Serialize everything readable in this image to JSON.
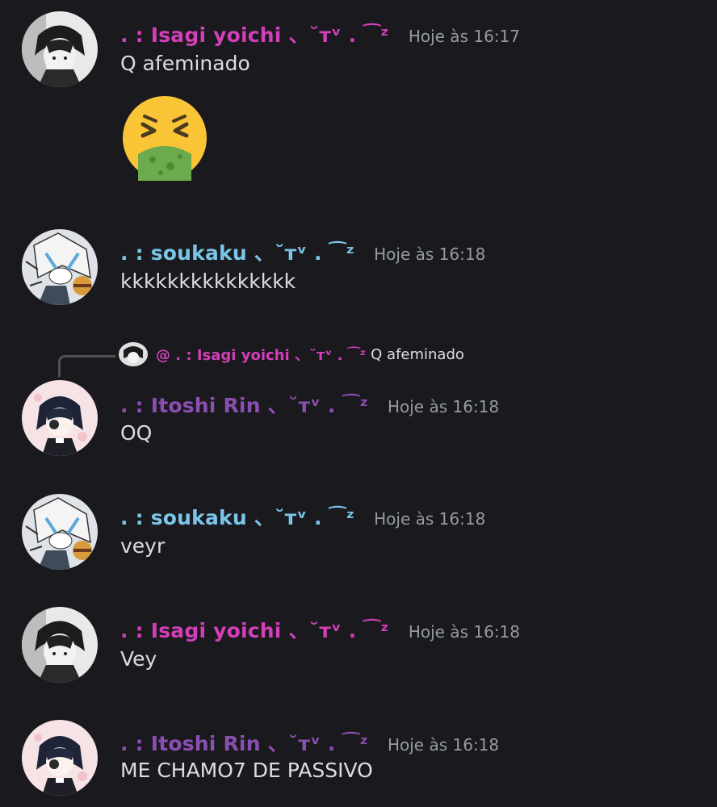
{
  "messages": [
    {
      "username": ". : Isagi yoichi 、˘ᴛᵛ . ⁀ᶻ",
      "timestamp": "Hoje às 16:17",
      "text": "Q afeminado"
    },
    {
      "username": ". : soukaku 、˘ᴛᵛ . ⁀ᶻ",
      "timestamp": "Hoje às 16:18",
      "text": "kkkkkkkkkkkkkkk"
    },
    {
      "username": ". : Itoshi Rin 、˘ᴛᵛ . ⁀ᶻ",
      "timestamp": "Hoje às 16:18",
      "text": "OQ",
      "reply": {
        "mention": "@ . : Isagi yoichi 、˘ᴛᵛ . ⁀ᶻ",
        "text": "Q afeminado"
      }
    },
    {
      "username": ". : soukaku 、˘ᴛᵛ . ⁀ᶻ",
      "timestamp": "Hoje às 16:18",
      "text": "veyr"
    },
    {
      "username": ". : Isagi yoichi 、˘ᴛᵛ . ⁀ᶻ",
      "timestamp": "Hoje às 16:18",
      "text": "Vey"
    },
    {
      "username": ". : Itoshi Rin 、˘ᴛᵛ . ⁀ᶻ",
      "timestamp": "Hoje às 16:18",
      "text": "ME CHAMO7 DE PASSIVO"
    }
  ],
  "emoji": {
    "name": "face-vomiting-emoji"
  },
  "colors": {
    "isagi": "#d23fb8",
    "soukaku": "#7ac5e8",
    "rin": "#8a4fb0",
    "timestamp": "#949ba4",
    "background": "#1a1a1e"
  }
}
